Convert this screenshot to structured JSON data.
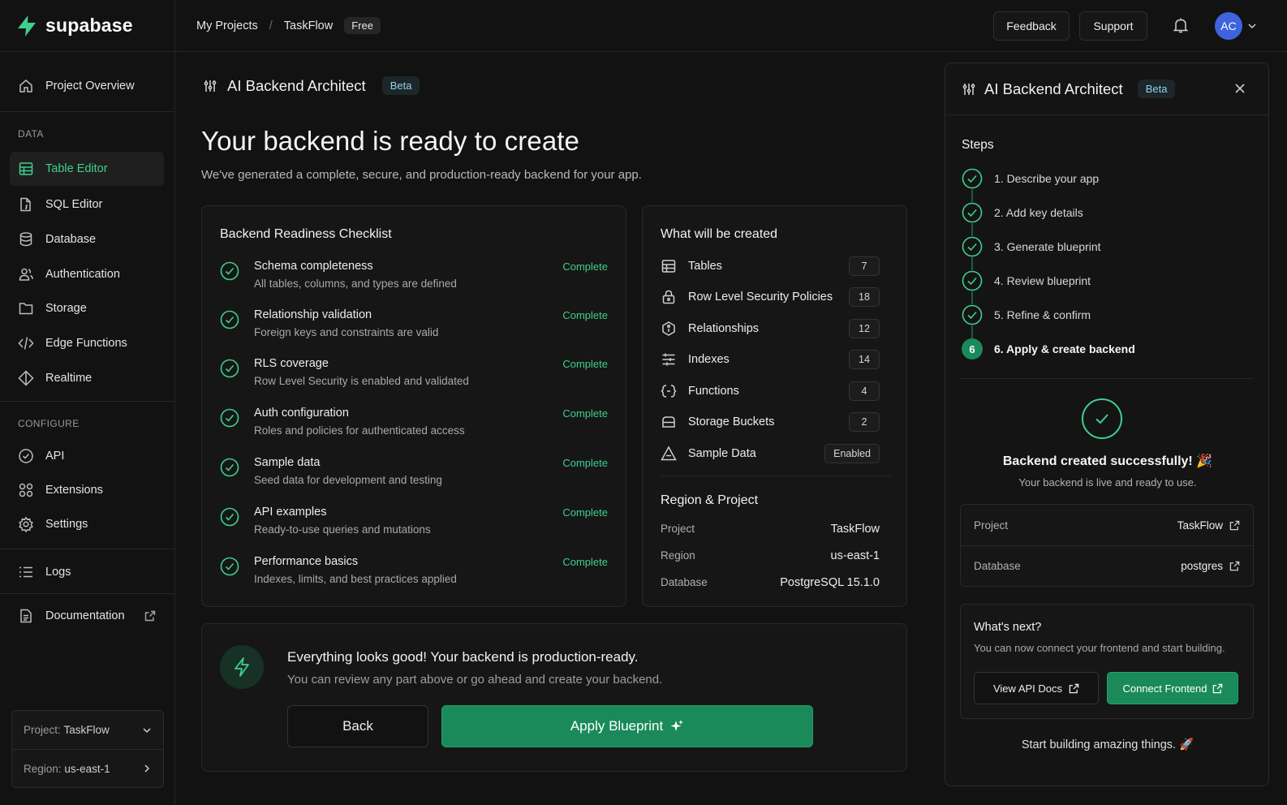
{
  "brand": {
    "name": "supabase"
  },
  "sidebar": {
    "overview": "Project Overview",
    "data_section": "DATA",
    "data_items": [
      {
        "label": "Table Editor",
        "icon": "table-icon",
        "active": true
      },
      {
        "label": "SQL Editor",
        "icon": "sql-file-icon"
      },
      {
        "label": "Database",
        "icon": "database-icon"
      },
      {
        "label": "Authentication",
        "icon": "users-icon"
      },
      {
        "label": "Storage",
        "icon": "folder-icon"
      },
      {
        "label": "Edge Functions",
        "icon": "code-icon"
      },
      {
        "label": "Realtime",
        "icon": "realtime-icon"
      }
    ],
    "configure_section": "CONFIGURE",
    "configure_items": [
      {
        "label": "API",
        "icon": "api-icon"
      },
      {
        "label": "Extensions",
        "icon": "extensions-icon"
      },
      {
        "label": "Settings",
        "icon": "gear-icon"
      }
    ],
    "logs": "Logs",
    "documentation": "Documentation",
    "project_label": "Project:",
    "project_value": "TaskFlow",
    "region_label": "Region:",
    "region_value": "us-east-1"
  },
  "topbar": {
    "crumb_projects": "My Projects",
    "crumb_sep": "/",
    "crumb_project": "TaskFlow",
    "plan": "Free",
    "feedback": "Feedback",
    "support": "Support",
    "avatar_initials": "AC"
  },
  "main": {
    "architect_title": "AI Backend Architect",
    "beta": "Beta",
    "heading": "Your backend is ready to create",
    "subheading": "We've generated a complete, secure, and production-ready backend for your app.",
    "checklist": {
      "title": "Backend Readiness Checklist",
      "items": [
        {
          "title": "Schema completeness",
          "desc": "All tables, columns, and types are defined",
          "status": "Complete"
        },
        {
          "title": "Relationship validation",
          "desc": "Foreign keys and constraints are valid",
          "status": "Complete"
        },
        {
          "title": "RLS coverage",
          "desc": "Row Level Security is enabled and validated",
          "status": "Complete"
        },
        {
          "title": "Auth configuration",
          "desc": "Roles and policies for authenticated access",
          "status": "Complete"
        },
        {
          "title": "Sample data",
          "desc": "Seed data for development and testing",
          "status": "Complete"
        },
        {
          "title": "API examples",
          "desc": "Ready-to-use queries and mutations",
          "status": "Complete"
        },
        {
          "title": "Performance basics",
          "desc": "Indexes, limits, and best practices applied",
          "status": "Complete"
        }
      ]
    },
    "created": {
      "title": "What will be created",
      "items": [
        {
          "label": "Tables",
          "value": "7",
          "icon": "table-icon"
        },
        {
          "label": "Row Level Security Policies",
          "value": "18",
          "icon": "lock-icon"
        },
        {
          "label": "Relationships",
          "value": "12",
          "icon": "relationship-icon"
        },
        {
          "label": "Indexes",
          "value": "14",
          "icon": "index-icon"
        },
        {
          "label": "Functions",
          "value": "4",
          "icon": "function-icon"
        },
        {
          "label": "Storage Buckets",
          "value": "2",
          "icon": "bucket-icon"
        },
        {
          "label": "Sample Data",
          "value": "Enabled",
          "icon": "flask-icon"
        }
      ]
    },
    "region": {
      "title": "Region & Project",
      "rows": [
        {
          "key": "Project",
          "value": "TaskFlow"
        },
        {
          "key": "Region",
          "value": "us-east-1"
        },
        {
          "key": "Database",
          "value": "PostgreSQL 15.1.0"
        }
      ]
    },
    "ready": {
      "title": "Everything looks good! Your backend is production-ready.",
      "subtitle": "You can review any part above or go ahead and create your backend.",
      "back": "Back",
      "apply": "Apply Blueprint"
    }
  },
  "panel": {
    "title": "AI Backend Architect",
    "beta": "Beta",
    "steps_title": "Steps",
    "steps": [
      {
        "label": "1. Describe your app",
        "done": true
      },
      {
        "label": "2. Add key details",
        "done": true
      },
      {
        "label": "3. Generate blueprint",
        "done": true
      },
      {
        "label": "4. Review blueprint",
        "done": true
      },
      {
        "label": "5. Refine & confirm",
        "done": true
      },
      {
        "label": "6. Apply & create backend",
        "done": false,
        "number": "6"
      }
    ],
    "success_title": "Backend created successfully! 🎉",
    "success_sub": "Your backend is live and ready to use.",
    "info": [
      {
        "key": "Project",
        "value": "TaskFlow"
      },
      {
        "key": "Database",
        "value": "postgres"
      }
    ],
    "next_title": "What's next?",
    "next_sub": "You can now connect your frontend and start building.",
    "view_docs": "View API Docs",
    "connect": "Connect Frontend",
    "footer": "Start building amazing things. 🚀"
  },
  "colors": {
    "accent": "#3ecf8e",
    "button": "#1a8a5a",
    "background": "#121212"
  }
}
